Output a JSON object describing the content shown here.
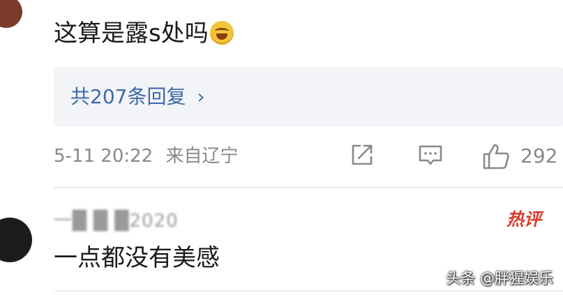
{
  "comment_1": {
    "text": "这算是露s处吗",
    "emoji": "laughing-crying-emoji"
  },
  "replies": {
    "label": "共207条回复",
    "chevron": "›"
  },
  "meta": {
    "timestamp": "5-11 20:22",
    "location": "来自辽宁"
  },
  "actions": {
    "share_icon": "share-icon",
    "comment_icon": "comment-icon",
    "like_icon": "thumbs-up-icon",
    "like_count": "292"
  },
  "comment_2": {
    "username": "一█ █ █2020",
    "badge": "热评",
    "text": "一点都没有美感"
  },
  "watermark": "头条 @胖猩娱乐",
  "colors": {
    "link": "#3d6aa8",
    "meta": "#888888",
    "hot_badge": "#d93b2b",
    "replies_bg": "#f2f4f7"
  }
}
